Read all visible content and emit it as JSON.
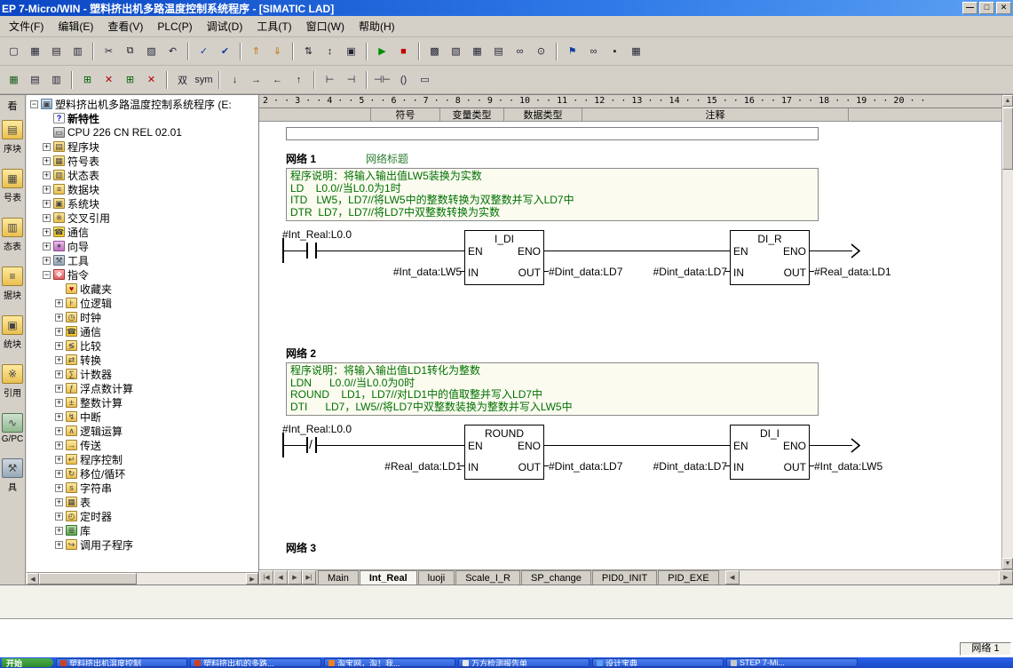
{
  "colors": {
    "comment_green": "#007000",
    "run_green": "#009000",
    "stop_red": "#c00000",
    "title_blue": "#0c46c4",
    "taskbar_blue": "#2a62e8"
  },
  "window": {
    "title": "EP 7-Micro/WIN  -  塑料挤出机多路温度控制系统程序  -  [SIMATIC LAD]",
    "controls": [
      {
        "name": "minimize-button",
        "glyph": "—"
      },
      {
        "name": "maximize-button",
        "glyph": "□"
      },
      {
        "name": "close-button",
        "glyph": "✕"
      }
    ]
  },
  "menu": {
    "items": [
      "文件(F)",
      "编辑(E)",
      "查看(V)",
      "PLC(P)",
      "调试(D)",
      "工具(T)",
      "窗口(W)",
      "帮助(H)"
    ]
  },
  "toolbar_main": {
    "buttons": [
      {
        "name": "new-file-icon",
        "glyph": "▢"
      },
      {
        "name": "open-file-icon",
        "glyph": "▦"
      },
      {
        "name": "print-icon",
        "glyph": "▤"
      },
      {
        "name": "print-preview-icon",
        "glyph": "▥"
      },
      {
        "sep": true
      },
      {
        "name": "cut-icon",
        "glyph": "✂"
      },
      {
        "name": "copy-icon",
        "glyph": "⧉"
      },
      {
        "name": "paste-icon",
        "glyph": "▨"
      },
      {
        "name": "undo-icon",
        "glyph": "↶"
      },
      {
        "sep": true
      },
      {
        "name": "compile-icon",
        "glyph": "✓",
        "color": "#1040a0"
      },
      {
        "name": "compile-all-icon",
        "glyph": "✔",
        "color": "#1040a0"
      },
      {
        "sep": true
      },
      {
        "name": "upload-icon",
        "glyph": "⇑",
        "color": "#c07000"
      },
      {
        "name": "download-icon",
        "glyph": "⇓",
        "color": "#c07000"
      },
      {
        "sep": true
      },
      {
        "name": "sort-ascending-icon",
        "glyph": "⇅"
      },
      {
        "name": "sort-descending-icon",
        "glyph": "↕"
      },
      {
        "name": "options-icon",
        "glyph": "▣"
      },
      {
        "sep": true
      },
      {
        "name": "run-icon",
        "glyph": "▶",
        "color": "#009000"
      },
      {
        "name": "stop-icon",
        "glyph": "■",
        "color": "#c00000"
      },
      {
        "sep": true
      },
      {
        "name": "program-status-icon",
        "glyph": "▩"
      },
      {
        "name": "chart-status-icon",
        "glyph": "▧"
      },
      {
        "name": "status-table-icon",
        "glyph": "▦"
      },
      {
        "name": "trend-view-icon",
        "glyph": "▤"
      },
      {
        "name": "glasses-icon",
        "glyph": "∞"
      },
      {
        "name": "zoom-icon",
        "glyph": "⊙"
      },
      {
        "sep": true
      },
      {
        "name": "bookmark-icon",
        "glyph": "⚑",
        "color": "#1040a0"
      },
      {
        "name": "link-icon",
        "glyph": "∞"
      },
      {
        "name": "lock-icon",
        "glyph": "▪"
      },
      {
        "name": "insert-table-icon",
        "glyph": "▦"
      }
    ]
  },
  "toolbar_lad": {
    "buttons": [
      {
        "name": "symbol-table-toggle-icon",
        "glyph": "▦",
        "color": "#206020"
      },
      {
        "name": "pou-comments-icon",
        "glyph": "▤"
      },
      {
        "name": "view-grid-icon",
        "glyph": "▥"
      },
      {
        "sep": true
      },
      {
        "name": "insert-network-icon",
        "glyph": "⊞",
        "color": "#006000"
      },
      {
        "name": "delete-network-icon",
        "glyph": "✕",
        "color": "#b00000"
      },
      {
        "name": "insert-row-icon",
        "glyph": "⊞",
        "color": "#006000"
      },
      {
        "name": "delete-row-icon",
        "glyph": "✕",
        "color": "#b00000"
      },
      {
        "sep": true
      },
      {
        "name": "symbol-info-icon",
        "glyph": "双"
      },
      {
        "name": "symbolic-addressing-icon",
        "glyph": "sym"
      },
      {
        "sep": true
      },
      {
        "name": "line-down-icon",
        "glyph": "↓"
      },
      {
        "name": "line-right-icon",
        "glyph": "→"
      },
      {
        "name": "line-left-icon",
        "glyph": "←"
      },
      {
        "name": "line-up-icon",
        "glyph": "↑"
      },
      {
        "sep": true
      },
      {
        "name": "insert-vertical-line-icon",
        "glyph": "⊢"
      },
      {
        "name": "insert-horizontal-line-icon",
        "glyph": "⊣"
      },
      {
        "sep": true
      },
      {
        "name": "insert-contact-icon",
        "glyph": "⊣⊢"
      },
      {
        "name": "insert-coil-icon",
        "glyph": "()"
      },
      {
        "name": "insert-box-icon",
        "glyph": "▭"
      }
    ]
  },
  "viewbar": {
    "header": "看",
    "items": [
      {
        "label": "序块",
        "icon": "program-block-icon"
      },
      {
        "label": "号表",
        "icon": "symbol-table-icon"
      },
      {
        "label": "态表",
        "icon": "status-chart-icon"
      },
      {
        "label": "据块",
        "icon": "data-block-icon"
      },
      {
        "label": "统块",
        "icon": "system-block-icon"
      },
      {
        "label": "引用",
        "icon": "cross-reference-icon"
      },
      {
        "label": "G/PC",
        "icon": "pgpc-interface-icon"
      },
      {
        "label": "具",
        "icon": "tools-icon"
      }
    ]
  },
  "project_tree": {
    "rows": [
      {
        "label": "塑料挤出机多路温度控制系统程序 (E:",
        "level": 0,
        "icon": "project-icon",
        "expand": "minus"
      },
      {
        "label": "新特性",
        "level": 1,
        "icon": "whats-new-icon",
        "expand": "none",
        "bold": true
      },
      {
        "label": "CPU 226 CN REL 02.01",
        "level": 1,
        "icon": "cpu-icon",
        "expand": "none"
      },
      {
        "label": "程序块",
        "level": 1,
        "icon": "program-block-icon",
        "expand": "plus"
      },
      {
        "label": "符号表",
        "level": 1,
        "icon": "symbol-table-icon",
        "expand": "plus"
      },
      {
        "label": "状态表",
        "level": 1,
        "icon": "status-chart-icon",
        "expand": "plus"
      },
      {
        "label": "数据块",
        "level": 1,
        "icon": "data-block-icon",
        "expand": "plus"
      },
      {
        "label": "系统块",
        "level": 1,
        "icon": "system-block-icon",
        "expand": "plus"
      },
      {
        "label": "交叉引用",
        "level": 1,
        "icon": "cross-reference-icon",
        "expand": "plus"
      },
      {
        "label": "通信",
        "level": 1,
        "icon": "communications-icon",
        "expand": "plus"
      },
      {
        "label": "向导",
        "level": 1,
        "icon": "wizards-icon",
        "expand": "plus"
      },
      {
        "label": "工具",
        "level": 1,
        "icon": "tools-icon",
        "expand": "plus"
      },
      {
        "label": "指令",
        "level": 1,
        "icon": "instructions-icon",
        "expand": "minus"
      },
      {
        "label": "收藏夹",
        "level": 2,
        "icon": "favorites-icon",
        "expand": "none"
      },
      {
        "label": "位逻辑",
        "level": 2,
        "icon": "bit-logic-icon",
        "expand": "plus"
      },
      {
        "label": "时钟",
        "level": 2,
        "icon": "clock-icon",
        "expand": "plus"
      },
      {
        "label": "通信",
        "level": 2,
        "icon": "communications-icon",
        "expand": "plus"
      },
      {
        "label": "比较",
        "level": 2,
        "icon": "compare-icon",
        "expand": "plus"
      },
      {
        "label": "转换",
        "level": 2,
        "icon": "convert-icon",
        "expand": "plus"
      },
      {
        "label": "计数器",
        "level": 2,
        "icon": "counters-icon",
        "expand": "plus"
      },
      {
        "label": "浮点数计算",
        "level": 2,
        "icon": "float-math-icon",
        "expand": "plus"
      },
      {
        "label": "整数计算",
        "level": 2,
        "icon": "integer-math-icon",
        "expand": "plus"
      },
      {
        "label": "中断",
        "level": 2,
        "icon": "interrupt-icon",
        "expand": "plus"
      },
      {
        "label": "逻辑运算",
        "level": 2,
        "icon": "logic-ops-icon",
        "expand": "plus"
      },
      {
        "label": "传送",
        "level": 2,
        "icon": "move-icon",
        "expand": "plus"
      },
      {
        "label": "程序控制",
        "level": 2,
        "icon": "program-control-icon",
        "expand": "plus"
      },
      {
        "label": "移位/循环",
        "level": 2,
        "icon": "shift-rotate-icon",
        "expand": "plus"
      },
      {
        "label": "字符串",
        "level": 2,
        "icon": "string-icon",
        "expand": "plus"
      },
      {
        "label": "表",
        "level": 2,
        "icon": "table-icon",
        "expand": "plus"
      },
      {
        "label": "定时器",
        "level": 2,
        "icon": "timers-icon",
        "expand": "plus"
      },
      {
        "label": "库",
        "level": 2,
        "icon": "libraries-icon",
        "expand": "plus"
      },
      {
        "label": "调用子程序",
        "level": 2,
        "icon": "call-subroutine-icon",
        "expand": "plus"
      }
    ]
  },
  "editor": {
    "ruler": "2 · · 3 · · 4 · · 5 · · 6 · · 7 · · 8 · · 9 · · 10 · · 11 · · 12 · · 13 · · 14 · · 15 · · 16 · · 17 · · 18 · · 19 · · 20 · ·",
    "columns": [
      "符号",
      "变量类型",
      "数据类型",
      "注释"
    ],
    "pins": {
      "en": "EN",
      "eno": "ENO",
      "in": "IN",
      "out": "OUT"
    },
    "networks": [
      {
        "title": "网络 1",
        "subtitle": "网络标题",
        "comment": "程序说明：将输入输出值LW5装换为实数\nLD    L0.0//当L0.0为1时\nITD   LW5，LD7//将LW5中的整数转换为双整数并写入LD7中\nDTR  LD7，LD7//将LD7中双整数转换为实数",
        "contact": {
          "label": "#Int_Real:L0.0",
          "symbol": ""
        },
        "boxes": [
          {
            "name": "I_DI",
            "in": "#Int_data:LW5",
            "out": "#Dint_data:LD7"
          },
          {
            "name": "DI_R",
            "in": "#Dint_data:LD7",
            "out": "#Real_data:LD1"
          }
        ]
      },
      {
        "title": "网络 2",
        "subtitle": "",
        "comment": "程序说明：将输入输出值LD1转化为整数\nLDN      L0.0//当L0.0为0时\nROUND    LD1，LD7//对LD1中的值取整并写入LD7中\nDTI      LD7，LW5//将LD7中双整数装换为整数并写入LW5中",
        "contact": {
          "label": "#Int_Real:L0.0",
          "symbol": "/"
        },
        "boxes": [
          {
            "name": "ROUND",
            "in": "#Real_data:LD1",
            "out": "#Dint_data:LD7"
          },
          {
            "name": "DI_I",
            "in": "#Dint_data:LD7",
            "out": "#Int_data:LW5"
          }
        ]
      },
      {
        "title": "网络 3"
      }
    ],
    "nav": {
      "first": "|◀",
      "prev": "◀",
      "next": "▶",
      "last": "▶|"
    },
    "tabs": [
      {
        "label": "Main"
      },
      {
        "label": "Int_Real",
        "active": true
      },
      {
        "label": "luoji"
      },
      {
        "label": "Scale_I_R"
      },
      {
        "label": "SP_change"
      },
      {
        "label": "PID0_INIT"
      },
      {
        "label": "PID_EXE"
      }
    ]
  },
  "scrollbars": {
    "up": "▲",
    "down": "▼",
    "left": "◀",
    "right": "▶"
  },
  "statusbar": {
    "network": "网络 1"
  },
  "taskbar": {
    "start": "开始",
    "buttons": [
      {
        "label": "塑料挤出机温度控制",
        "color": "#d04020"
      },
      {
        "label": "塑料挤出机的多路...",
        "color": "#d04020"
      },
      {
        "label": "淘宝网，淘！我...",
        "color": "#f08020"
      },
      {
        "label": "万方检测报告单",
        "color": "#e8e8e8"
      },
      {
        "label": "设计宝典",
        "color": "#60a0f0"
      },
      {
        "label": "STEP 7-Mi...",
        "color": "#c8c8c8"
      }
    ]
  }
}
